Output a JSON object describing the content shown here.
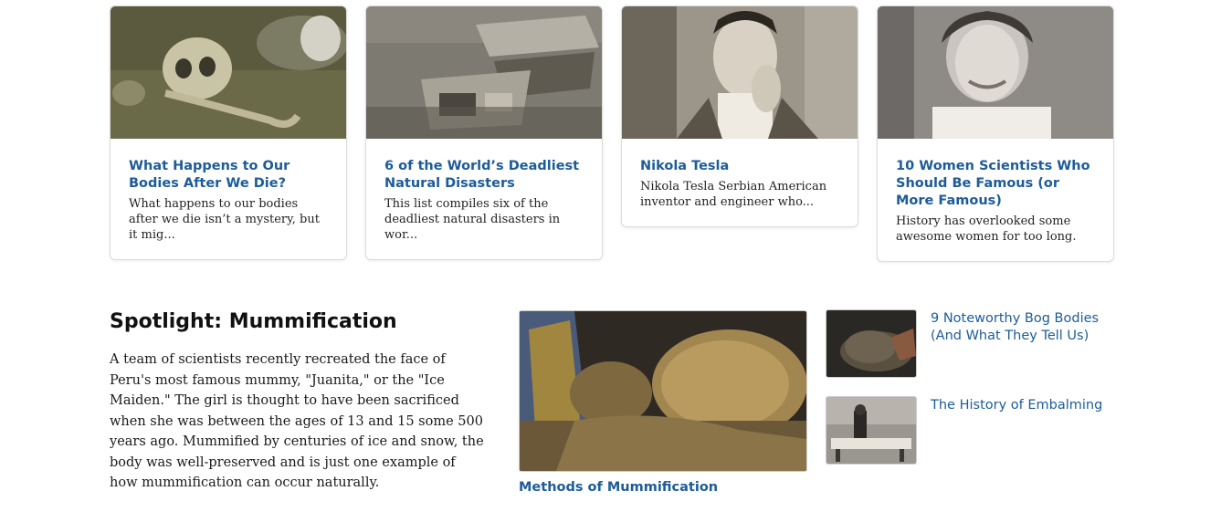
{
  "cards": [
    {
      "title": "What Happens to Our Bodies After We Die?",
      "desc": "What happens to our bodies after we die isn’t a mystery, but it mig...",
      "image": "skull-photo"
    },
    {
      "title": "6 of the World’s Deadliest Natural Disasters",
      "desc": "This list compiles six of the deadliest natural disasters in wor...",
      "image": "disaster-rubble-photo"
    },
    {
      "title": "Nikola Tesla",
      "desc": "Nikola Tesla Serbian American inventor and engineer who...",
      "image": "tesla-portrait-photo"
    },
    {
      "title": "10 Women Scientists Who Should Be Famous (or More Famous)",
      "desc": "History has overlooked some awesome women for too long.",
      "image": "woman-scientist-photo"
    }
  ],
  "spotlight": {
    "heading": "Spotlight: Mummification",
    "text": "A team of scientists recently recreated the face of Peru's most famous mummy, \"Juanita,\" or the \"Ice Maiden.\" The girl is thought to have been sacrificed when she was between the ages of 13 and 15 some 500 years ago. Mummified by centuries of ice and snow, the body was well-preserved and is just one example of how mummification can occur naturally.",
    "main": {
      "caption": "Methods of Mummification",
      "image": "mummy-photo"
    },
    "side": [
      {
        "label": "9 Noteworthy Bog Bodies (And What They Tell Us)",
        "image": "bog-body-photo"
      },
      {
        "label": "The History of Embalming",
        "image": "embalming-photo"
      }
    ]
  },
  "colors": {
    "link": "#1d5c99",
    "text": "#1a1a1a",
    "border": "#dcdcdc"
  }
}
